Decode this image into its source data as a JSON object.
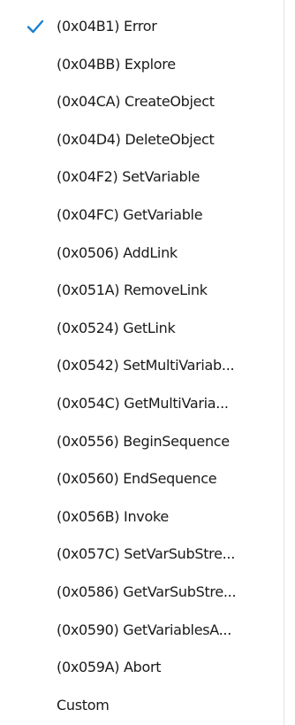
{
  "menu": {
    "accent_color": "#1a7fd0",
    "checkmark_icon": "checkmark-icon",
    "items": [
      {
        "label": "(0x04B1) Error",
        "checked": true
      },
      {
        "label": "(0x04BB) Explore",
        "checked": false
      },
      {
        "label": "(0x04CA) CreateObject",
        "checked": false
      },
      {
        "label": "(0x04D4) DeleteObject",
        "checked": false
      },
      {
        "label": "(0x04F2) SetVariable",
        "checked": false
      },
      {
        "label": "(0x04FC) GetVariable",
        "checked": false
      },
      {
        "label": "(0x0506) AddLink",
        "checked": false
      },
      {
        "label": "(0x051A) RemoveLink",
        "checked": false
      },
      {
        "label": "(0x0524) GetLink",
        "checked": false
      },
      {
        "label": "(0x0542) SetMultiVariab...",
        "checked": false
      },
      {
        "label": "(0x054C) GetMultiVaria...",
        "checked": false
      },
      {
        "label": "(0x0556) BeginSequence",
        "checked": false
      },
      {
        "label": "(0x0560) EndSequence",
        "checked": false
      },
      {
        "label": "(0x056B) Invoke",
        "checked": false
      },
      {
        "label": "(0x057C) SetVarSubStre...",
        "checked": false
      },
      {
        "label": "(0x0586) GetVarSubStre...",
        "checked": false
      },
      {
        "label": "(0x0590) GetVariablesA...",
        "checked": false
      },
      {
        "label": "(0x059A) Abort",
        "checked": false
      },
      {
        "label": "Custom",
        "checked": false
      }
    ]
  }
}
